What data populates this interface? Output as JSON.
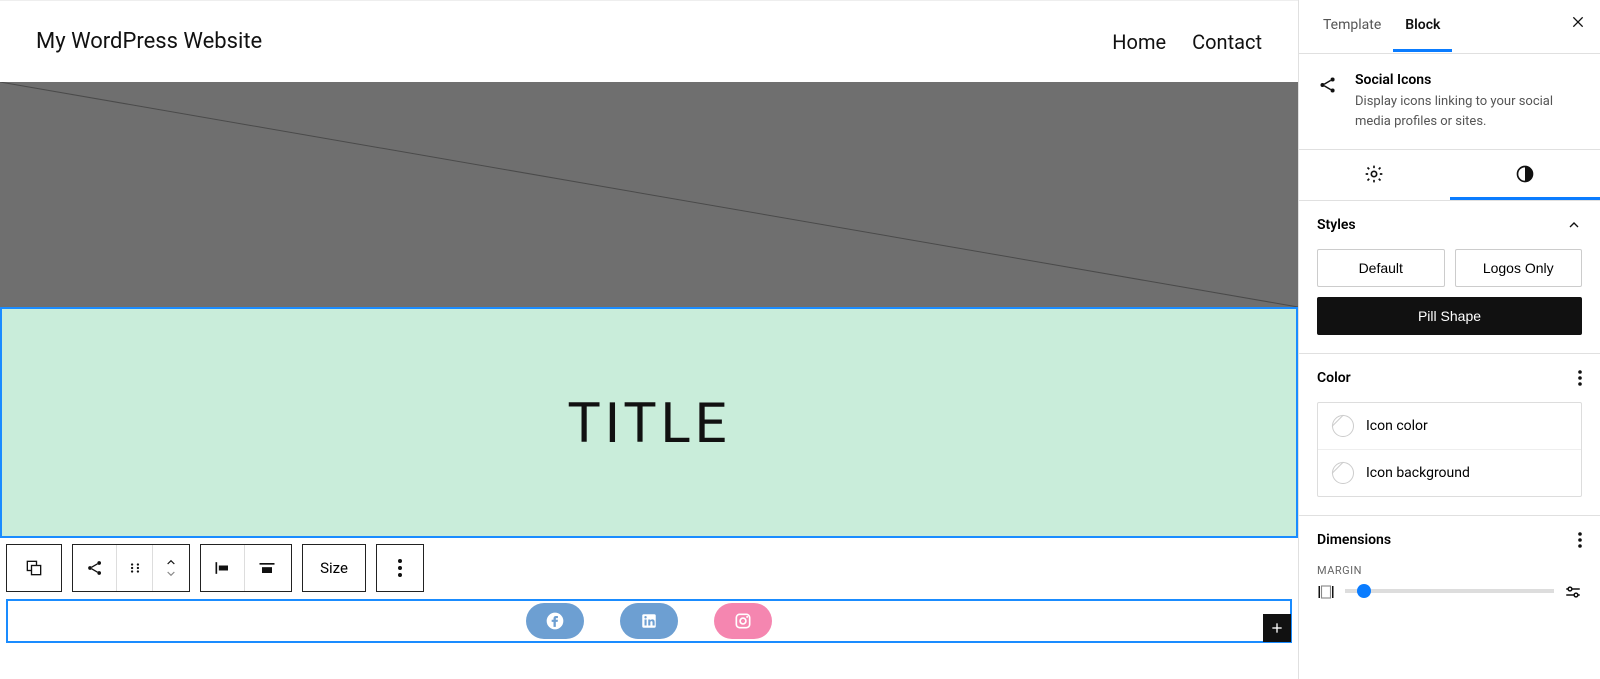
{
  "site": {
    "title": "My WordPress Website"
  },
  "nav": {
    "items": [
      "Home",
      "Contact"
    ]
  },
  "hero": {
    "title": "TITLE"
  },
  "toolbar": {
    "size_label": "Size"
  },
  "social": {
    "items": [
      {
        "name": "facebook",
        "bg": "#6d9fd2"
      },
      {
        "name": "linkedin",
        "bg": "#6d9fd2"
      },
      {
        "name": "instagram",
        "bg": "#f586b0"
      }
    ]
  },
  "sidebar": {
    "tabs": {
      "template": "Template",
      "block": "Block"
    },
    "block": {
      "title": "Social Icons",
      "desc": "Display icons linking to your social media profiles or sites."
    },
    "panels": {
      "styles": {
        "title": "Styles",
        "options": [
          "Default",
          "Logos Only",
          "Pill Shape"
        ],
        "active": "Pill Shape"
      },
      "color": {
        "title": "Color",
        "rows": [
          "Icon color",
          "Icon background"
        ]
      },
      "dimensions": {
        "title": "Dimensions",
        "margin_label": "MARGIN"
      }
    }
  }
}
